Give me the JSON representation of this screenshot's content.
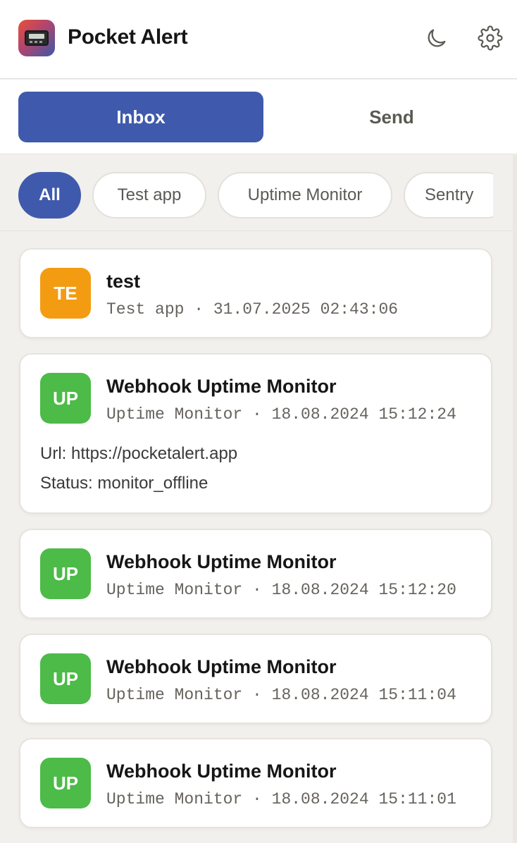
{
  "app": {
    "title": "Pocket Alert",
    "logo_icon": "pager-icon",
    "theme_toggle_icon": "moon-icon",
    "settings_icon": "gear-icon"
  },
  "tabs": [
    {
      "label": "Inbox",
      "active": true
    },
    {
      "label": "Send",
      "active": false
    }
  ],
  "filters": [
    {
      "label": "All",
      "active": true
    },
    {
      "label": "Test app",
      "active": false
    },
    {
      "label": "Uptime Monitor",
      "active": false
    },
    {
      "label": "Sentry",
      "active": false
    }
  ],
  "colors": {
    "accent": "#3f5aad",
    "avatar_test": "#f39c12",
    "avatar_uptime": "#4cbb47",
    "background": "#f2f0ec"
  },
  "messages": [
    {
      "initials": "TE",
      "title": "test",
      "meta": "Test app · 31.07.2025 02:43:06",
      "body": []
    },
    {
      "initials": "UP",
      "title": "Webhook Uptime Monitor",
      "meta": "Uptime Monitor · 18.08.2024 15:12:24",
      "body": [
        "Url: https://pocketalert.app",
        "Status: monitor_offline"
      ]
    },
    {
      "initials": "UP",
      "title": "Webhook Uptime Monitor",
      "meta": "Uptime Monitor · 18.08.2024 15:12:20",
      "body": []
    },
    {
      "initials": "UP",
      "title": "Webhook Uptime Monitor",
      "meta": "Uptime Monitor · 18.08.2024 15:11:04",
      "body": []
    },
    {
      "initials": "UP",
      "title": "Webhook Uptime Monitor",
      "meta": "Uptime Monitor · 18.08.2024 15:11:01",
      "body": []
    }
  ]
}
